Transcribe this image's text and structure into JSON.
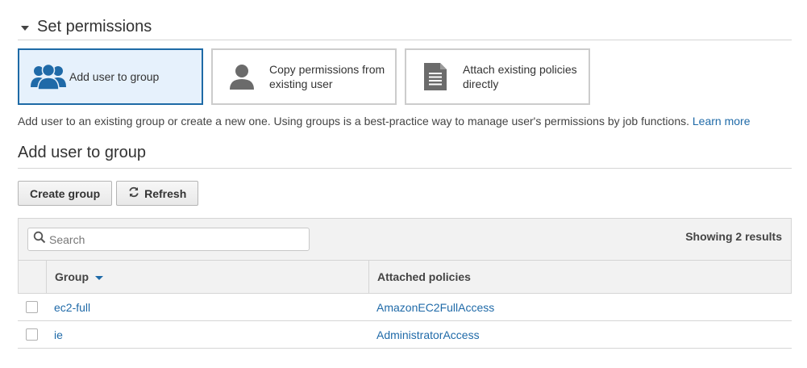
{
  "section": {
    "title": "Set permissions"
  },
  "options": [
    {
      "label": "Add user to group",
      "icon": "group-icon",
      "selected": true
    },
    {
      "label_line1": "Copy permissions from",
      "label_line2": "existing user",
      "icon": "user-icon",
      "selected": false
    },
    {
      "label_line1": "Attach existing policies",
      "label_line2": "directly",
      "icon": "document-icon",
      "selected": false
    }
  ],
  "description": {
    "text": "Add user to an existing group or create a new one. Using groups is a best-practice way to manage user's permissions by job functions.",
    "link": "Learn more"
  },
  "subsection": {
    "title": "Add user to group"
  },
  "toolbar": {
    "create_label": "Create group",
    "refresh_label": "Refresh"
  },
  "table": {
    "search_placeholder": "Search",
    "results_text": "Showing 2 results",
    "columns": {
      "group": "Group",
      "policies": "Attached policies"
    },
    "rows": [
      {
        "group": "ec2-full",
        "policies": "AmazonEC2FullAccess"
      },
      {
        "group": "ie",
        "policies": "AdministratorAccess"
      }
    ]
  },
  "colors": {
    "accent": "#1f6aa8",
    "selected_bg": "#e6f1fc",
    "selected_border": "#1e6aa6",
    "icon_gray": "#6b6b6b"
  }
}
